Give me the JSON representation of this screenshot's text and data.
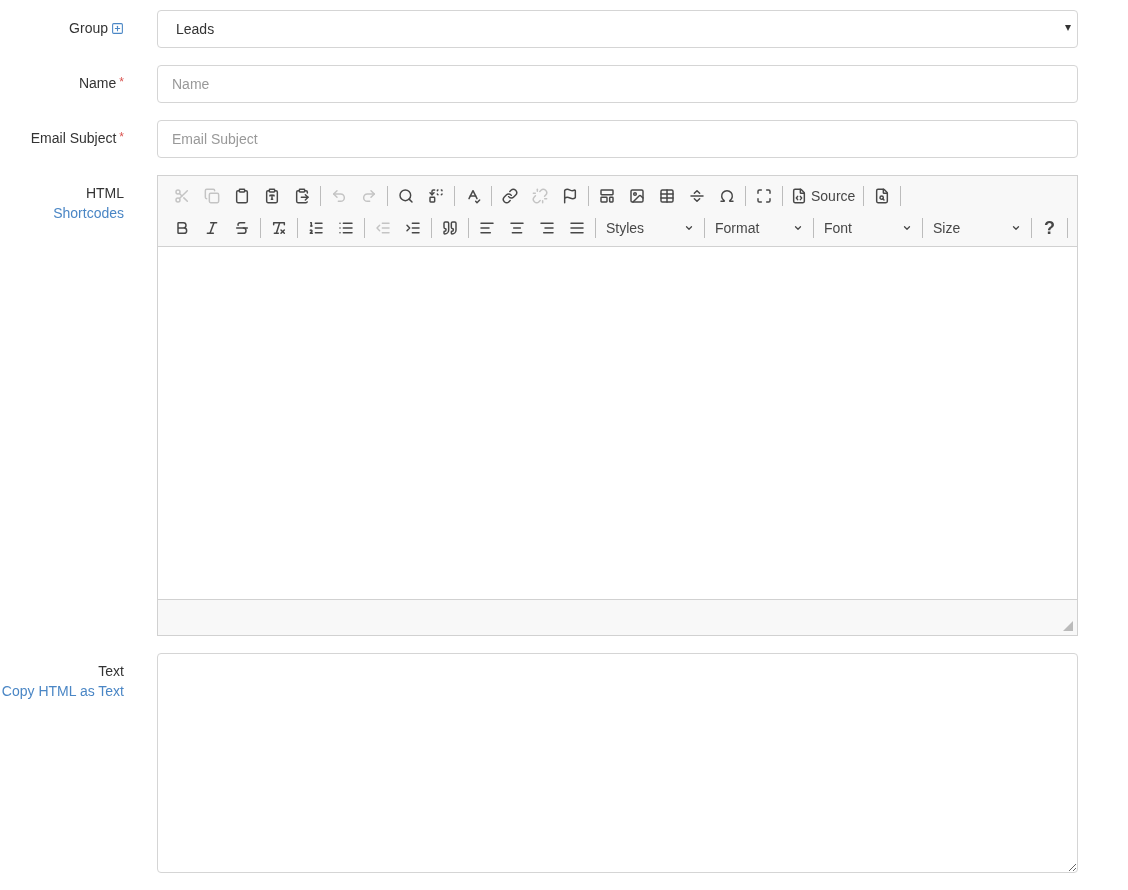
{
  "fields": [
    {
      "kind": "select",
      "label": "Group",
      "add_icon": true,
      "value": "Leads"
    },
    {
      "kind": "input",
      "label": "Name",
      "required_mark": "*",
      "placeholder": "Name"
    },
    {
      "kind": "input",
      "label": "Email Subject",
      "required_mark": "*",
      "placeholder": "Email Subject"
    },
    {
      "kind": "editor",
      "label": "HTML",
      "link": "Shortcodes",
      "toolbar_rows": [
        [
          [
            {
              "kind": "cut",
              "disabled": true
            },
            {
              "kind": "copy",
              "disabled": true
            },
            {
              "kind": "paste",
              "disabled": false
            },
            {
              "kind": "paste-text",
              "disabled": false
            },
            {
              "kind": "paste-word",
              "disabled": false
            }
          ],
          [
            {
              "kind": "undo",
              "disabled": true
            },
            {
              "kind": "redo",
              "disabled": true
            }
          ],
          [
            {
              "kind": "find",
              "disabled": false
            },
            {
              "kind": "replace",
              "disabled": false
            }
          ],
          [
            {
              "kind": "spellcheck",
              "disabled": false
            }
          ],
          [
            {
              "kind": "link",
              "disabled": false
            },
            {
              "kind": "unlink",
              "disabled": true
            },
            {
              "kind": "anchor",
              "disabled": false
            }
          ],
          [
            {
              "kind": "template",
              "disabled": false
            },
            {
              "kind": "image",
              "disabled": false
            },
            {
              "kind": "table",
              "disabled": false
            },
            {
              "kind": "rule",
              "disabled": false
            },
            {
              "kind": "special-char",
              "disabled": false
            }
          ],
          [
            {
              "kind": "maximize",
              "disabled": false
            }
          ],
          [
            {
              "kind": "source",
              "disabled": false,
              "label": "Source"
            }
          ],
          [
            {
              "kind": "preview",
              "disabled": false
            }
          ]
        ],
        [
          [
            {
              "kind": "bold",
              "disabled": false
            },
            {
              "kind": "italic",
              "disabled": false
            },
            {
              "kind": "strike",
              "disabled": false
            }
          ],
          [
            {
              "kind": "clear-format",
              "disabled": false
            }
          ],
          [
            {
              "kind": "ordered-list",
              "disabled": false
            },
            {
              "kind": "bullet-list",
              "disabled": false
            }
          ],
          [
            {
              "kind": "outdent",
              "disabled": true
            },
            {
              "kind": "indent",
              "disabled": false
            }
          ],
          [
            {
              "kind": "quote",
              "disabled": false
            }
          ],
          [
            {
              "kind": "align-left",
              "disabled": false
            },
            {
              "kind": "align-center",
              "disabled": false
            },
            {
              "kind": "align-right",
              "disabled": false
            },
            {
              "kind": "justify",
              "disabled": false
            }
          ],
          [
            {
              "kind": "combo",
              "label": "Styles"
            }
          ],
          [
            {
              "kind": "combo",
              "label": "Format"
            }
          ],
          [
            {
              "kind": "combo",
              "label": "Font"
            }
          ],
          [
            {
              "kind": "combo",
              "label": "Size"
            }
          ],
          [
            {
              "kind": "help",
              "label": "?",
              "disabled": false
            }
          ]
        ]
      ]
    },
    {
      "kind": "textarea",
      "label": "Text",
      "link": "Copy HTML as Text"
    }
  ]
}
